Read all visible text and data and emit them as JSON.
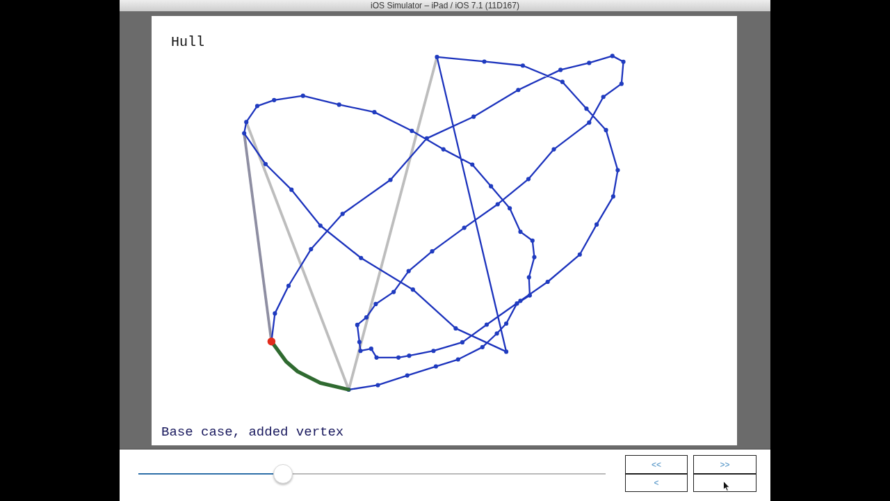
{
  "window": {
    "title": "iOS Simulator – iPad / iOS 7.1 (11D167)"
  },
  "canvas": {
    "title": "Hull",
    "caption": "Base case, added vertex"
  },
  "slider": {
    "level": 0.31
  },
  "buttons": [
    {
      "label": "<<",
      "pointer_over": false
    },
    {
      "label": ">>",
      "pointer_over": false
    },
    {
      "label": "<",
      "pointer_over": false
    },
    {
      "pointer_over": true
    }
  ]
}
